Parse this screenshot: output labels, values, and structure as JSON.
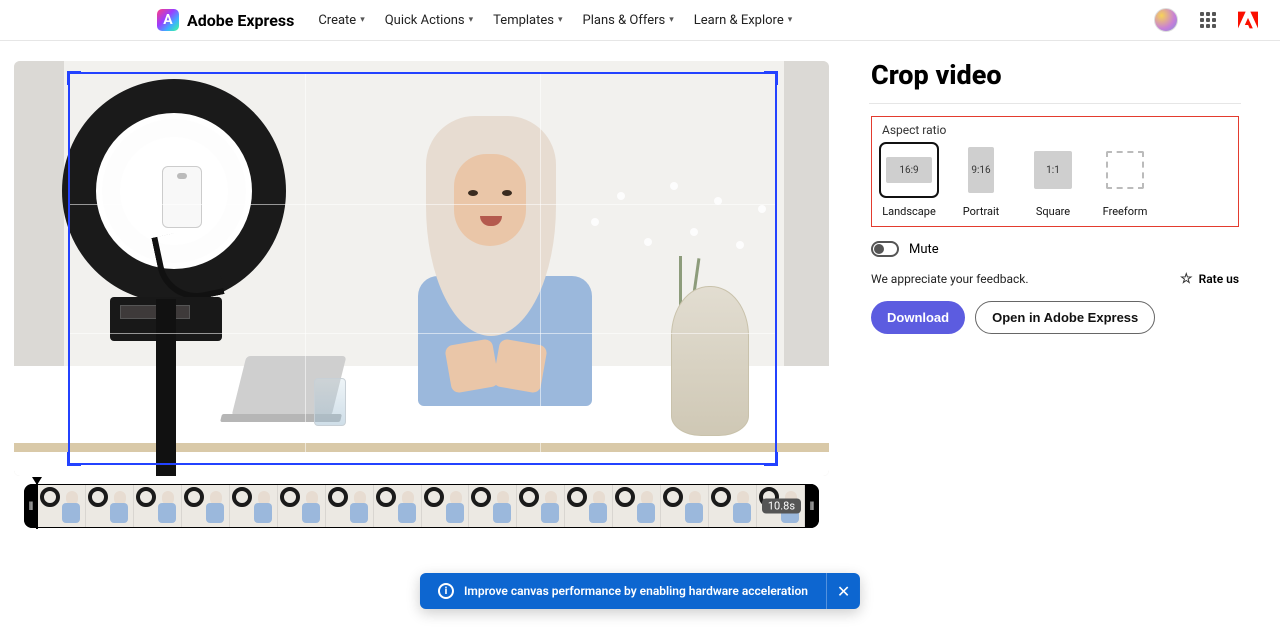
{
  "header": {
    "brand": "Adobe Express",
    "nav": {
      "create": "Create",
      "quick_actions": "Quick Actions",
      "templates": "Templates",
      "plans": "Plans & Offers",
      "learn": "Learn & Explore"
    }
  },
  "panel": {
    "title": "Crop video",
    "aspect_ratio": {
      "label": "Aspect ratio",
      "options": {
        "landscape": {
          "ratio": "16:9",
          "caption": "Landscape",
          "selected": true
        },
        "portrait": {
          "ratio": "9:16",
          "caption": "Portrait",
          "selected": false
        },
        "square": {
          "ratio": "1:1",
          "caption": "Square",
          "selected": false
        },
        "freeform": {
          "ratio": "",
          "caption": "Freeform",
          "selected": false
        }
      }
    },
    "mute": {
      "label": "Mute",
      "on": false
    },
    "feedback": {
      "text": "We appreciate your feedback.",
      "rate_label": "Rate us"
    },
    "cta": {
      "download": "Download",
      "open": "Open in Adobe Express"
    }
  },
  "timeline": {
    "duration_label": "10.8s"
  },
  "toast": {
    "message": "Improve canvas performance by enabling hardware acceleration"
  }
}
